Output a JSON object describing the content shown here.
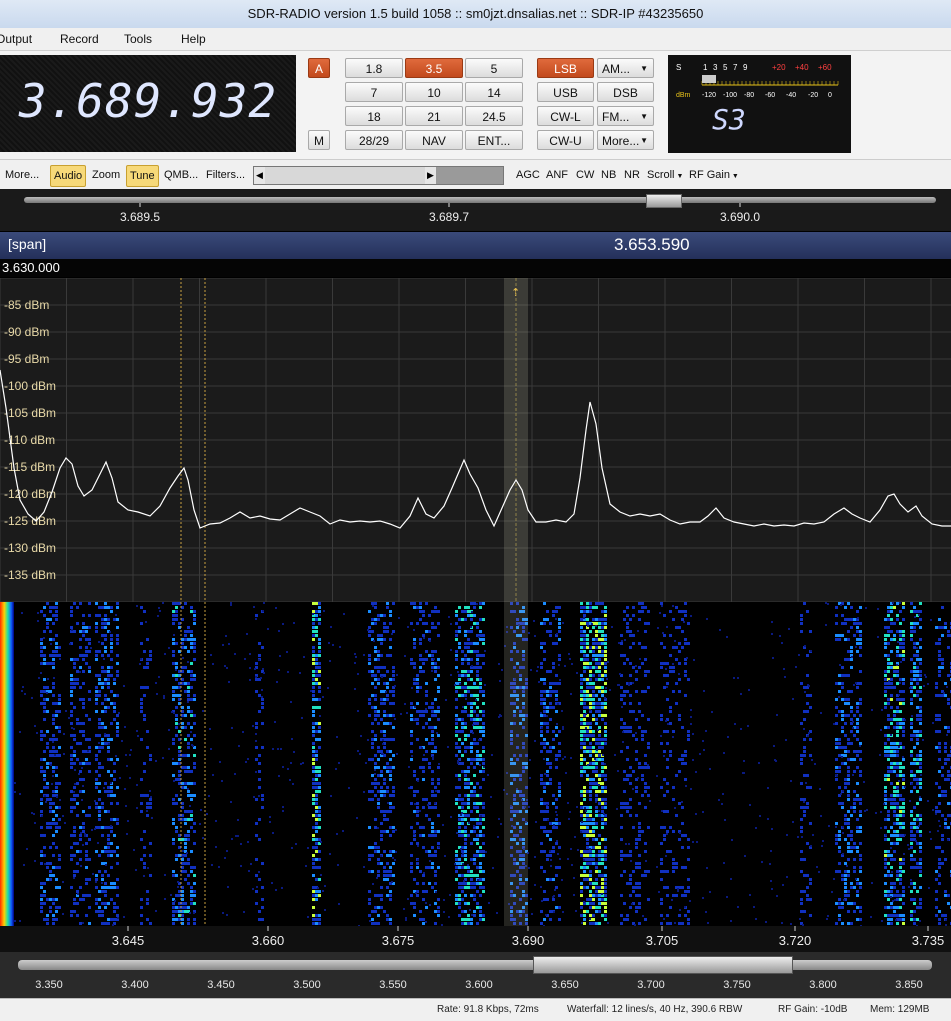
{
  "window": {
    "title": "SDR-RADIO version 1.5 build 1058 :: sm0jzt.dnsalias.net :: SDR-IP #43235650"
  },
  "menu": {
    "items": [
      "Output",
      "Record",
      "Tools",
      "Help"
    ]
  },
  "frequency": {
    "display": "3.689.932"
  },
  "panel": {
    "a_label": "A",
    "m_label": "M",
    "bands": [
      "1.8",
      "3.5",
      "5",
      "7",
      "10",
      "14",
      "18",
      "21",
      "24.5",
      "28/29",
      "NAV",
      "ENT..."
    ],
    "selected_band": "3.5",
    "modes": [
      "LSB",
      "AM...",
      "USB",
      "DSB",
      "CW-L",
      "FM...",
      "CW-U",
      "More..."
    ],
    "selected_mode": "LSB"
  },
  "smeter": {
    "reading": "S3",
    "s_scale": [
      "S",
      "1",
      "3",
      "5",
      "7",
      "9",
      "+20",
      "+40",
      "+60"
    ],
    "dbm_label": "dBm",
    "dbm_scale": [
      "-120",
      "-100",
      "-80",
      "-60",
      "-40",
      "-20",
      "0"
    ],
    "level_fraction": 0.1
  },
  "toolbar": {
    "left_items": [
      "More...",
      "Audio",
      "Zoom",
      "Tune",
      "QMB...",
      "Filters..."
    ],
    "active": [
      "Audio",
      "Tune"
    ],
    "right_items": [
      "AGC",
      "ANF",
      "CW",
      "NB",
      "NR",
      "Scroll",
      "RF Gain"
    ],
    "slider_fraction": 0.0
  },
  "top_scale": {
    "ticks": [
      "3.689.5",
      "3.689.7",
      "3.690.0"
    ]
  },
  "span": {
    "label": "[span]",
    "center": "3.653.590",
    "start": "3.630.000"
  },
  "spectrum": {
    "dbm_labels": [
      "-85 dBm",
      "-90 dBm",
      "-95 dBm",
      "-100 dBm",
      "-105 dBm",
      "-110 dBm",
      "-115 dBm",
      "-120 dBm",
      "-125 dBm",
      "-130 dBm",
      "-135 dBm"
    ]
  },
  "bottom_axis": {
    "ticks": [
      "3.645",
      "3.660",
      "3.675",
      "3.690",
      "3.705",
      "3.720",
      "3.735"
    ]
  },
  "bottom_scroll": {
    "ticks": [
      "3.350",
      "3.400",
      "3.450",
      "3.500",
      "3.550",
      "3.600",
      "3.650",
      "3.700",
      "3.750",
      "3.800",
      "3.850"
    ]
  },
  "status": {
    "rate": "Rate: 91.8 Kbps, 72ms",
    "waterfall": "Waterfall: 12 lines/s, 40 Hz, 390.6 RBW",
    "rf_gain": "RF Gain: -10dB",
    "mem": "Mem: 129MB"
  },
  "colors": {
    "accent": "#d2572a",
    "display_text": "#dfe7ff",
    "axis_label": "#e8d9a8",
    "trace": "#ffffff"
  }
}
